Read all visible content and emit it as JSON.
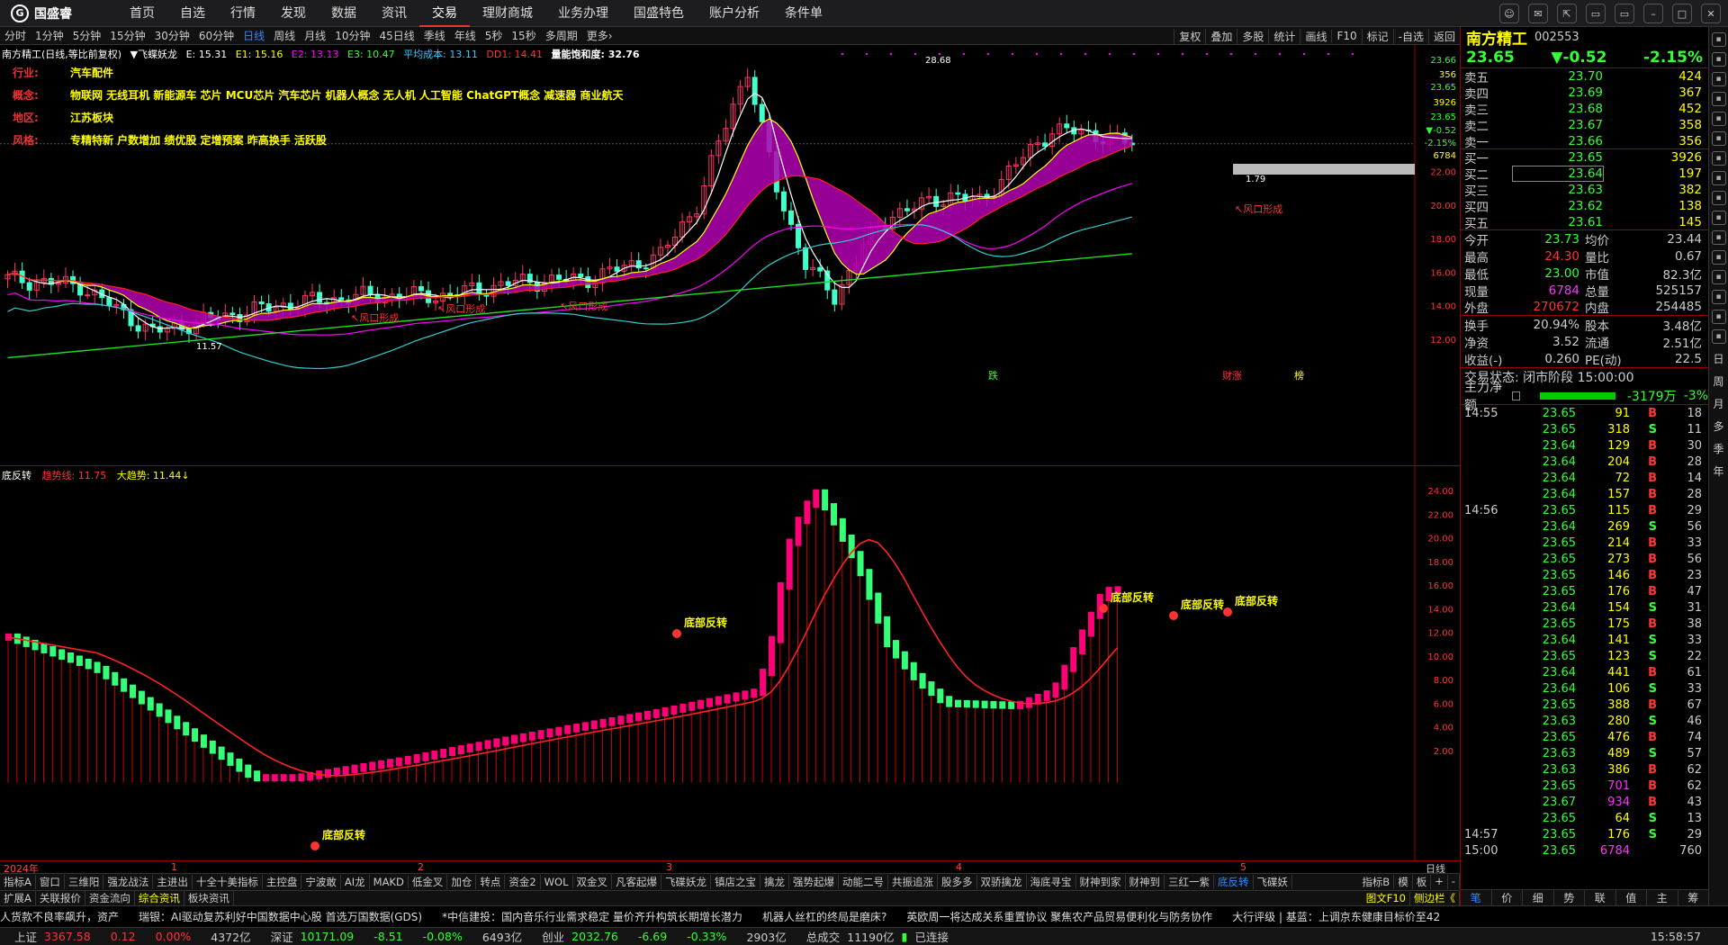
{
  "app": {
    "logo_text": "国盛睿",
    "logo_mark": "G"
  },
  "menu": [
    "首页",
    "自选",
    "行情",
    "发现",
    "数据",
    "资讯",
    "交易",
    "理财商城",
    "业务办理",
    "国盛特色",
    "账户分析",
    "条件单"
  ],
  "menu_active": 6,
  "window_controls": [
    "☺",
    "✉",
    "⇱",
    "▭",
    "▭",
    "–",
    "□",
    "✕"
  ],
  "periods": [
    "分时",
    "1分钟",
    "5分钟",
    "15分钟",
    "30分钟",
    "60分钟",
    "日线",
    "周线",
    "月线",
    "10分钟",
    "45日线",
    "季线",
    "年线",
    "5秒",
    "15秒",
    "多周期",
    "更多›"
  ],
  "period_active": 6,
  "chart_tools": [
    "复权",
    "叠加",
    "多股",
    "统计",
    "画线",
    "F10",
    "标记",
    "-自选",
    "返回"
  ],
  "main_info": {
    "title": "南方精工(日线,等比前复权)",
    "indicator": "▼飞蝶妖龙",
    "e": "E: 15.31",
    "e1": "E1: 15.16",
    "e2": "E2: 13.13",
    "e3": "E3: 10.47",
    "avg": "平均成本: 13.11",
    "dd": "DD1: 14.41",
    "qn": "量能饱和度: 32.76"
  },
  "info_blocks": [
    {
      "label": "行业:",
      "value": "汽车配件"
    },
    {
      "label": "概念:",
      "value": "物联网 无线耳机 新能源车 芯片 MCU芯片 汽车芯片 机器人概念 无人机 人工智能 ChatGPT概念 减速器 商业航天"
    },
    {
      "label": "地区:",
      "value": "江苏板块"
    },
    {
      "label": "风格:",
      "value": "专精特新 户数增加 绩优股 定增预案 昨高换手 活跃股"
    }
  ],
  "main_axis": [
    "23.66",
    "23.65",
    "23.65",
    "22.00",
    "20.00",
    "18.00",
    "16.00",
    "14.00",
    "12.00"
  ],
  "main_axis_extra": [
    "356",
    "3926",
    "▼-0.52",
    "-2.15%",
    "6784"
  ],
  "main_annotations": {
    "high": "28.68",
    "low": "11.57",
    "mid": "1.79",
    "wind": [
      "↖风口形成",
      "↖风口形成",
      "↖风口形成",
      "↖风口形成"
    ],
    "marks": [
      "跌",
      "财涨",
      "榜"
    ]
  },
  "sub_info": {
    "title": "底反转",
    "trend": "趋势线: 11.75",
    "big": "大趋势: 11.44↓"
  },
  "sub_axis": [
    "24.00",
    "22.00",
    "20.00",
    "18.00",
    "16.00",
    "14.00",
    "12.00",
    "10.00",
    "8.00",
    "6.00",
    "4.00",
    "2.00"
  ],
  "sub_annotations": [
    "底部反转",
    "底部反转",
    "底部反转",
    "底部反转",
    "底部反转"
  ],
  "time_axis": {
    "labels": [
      "2024年",
      "1",
      "2",
      "3",
      "4",
      "5"
    ],
    "right": "日线"
  },
  "indicator_tabs": [
    "指标A",
    "窗口",
    "三维阳",
    "强龙战法",
    "主进出",
    "十全十美指标",
    "主控盘",
    "宁波敢",
    "AI龙",
    "MAKD",
    "低金叉",
    "加仓",
    "转点",
    "资金2",
    "WOL",
    "双金叉",
    "凡客起爆",
    "飞碟妖龙",
    "镇店之宝",
    "擒龙",
    "强势起爆",
    "动能二号",
    "共振追涨",
    "股多多",
    "双骄擒龙",
    "海底寻宝",
    "财神到家",
    "财神到",
    "三红一紫",
    "底反转",
    "飞碟妖"
  ],
  "indicator_active": 29,
  "indicator_right": [
    "指标B",
    "模",
    "板",
    "+",
    "-"
  ],
  "bottom_tabs": [
    "扩展A",
    "关联报价",
    "资金流向",
    "综合资讯",
    "板块资讯"
  ],
  "bottom_active": 3,
  "bottom_right": [
    "图文F10",
    "侧边栏《"
  ],
  "news": [
    "人货款不良率飙升，资产",
    "瑞银：AI驱动复苏利好中国数据中心股 首选万国数据(GDS)",
    "*中信建投：国内音乐行业需求稳定 量价齐升构筑长期增长潜力",
    "机器人丝杠的终局是磨床?",
    "英欧周一将达成关系重置协议 聚焦农产品贸易便利化与防务协作",
    "大行评级 | 基蓝：上调京东健康目标价至42"
  ],
  "status": {
    "sh_label": "上证",
    "sh_val": "3367.58",
    "sh_chg": "0.12",
    "sh_pct": "0.00%",
    "sh_amt": "4372亿",
    "sz_label": "深证",
    "sz_val": "10171.09",
    "sz_chg": "-8.51",
    "sz_pct": "-0.08%",
    "sz_amt": "6493亿",
    "cy_label": "创业",
    "cy_val": "2032.76",
    "cy_chg": "-6.69",
    "cy_pct": "-0.33%",
    "cy_amt": "2903亿",
    "total_label": "总成交",
    "total": "11190亿",
    "conn": "已连接",
    "time": "15:58:57"
  },
  "quote": {
    "name": "南方精工",
    "code": "002553",
    "price": "23.65",
    "change": "▼-0.52",
    "pct": "-2.15%",
    "asks": [
      {
        "label": "卖五",
        "price": "23.70",
        "vol": "424"
      },
      {
        "label": "卖四",
        "price": "23.69",
        "vol": "367"
      },
      {
        "label": "卖三",
        "price": "23.68",
        "vol": "452"
      },
      {
        "label": "卖二",
        "price": "23.67",
        "vol": "358"
      },
      {
        "label": "卖一",
        "price": "23.66",
        "vol": "356"
      }
    ],
    "bids": [
      {
        "label": "买一",
        "price": "23.65",
        "vol": "3926"
      },
      {
        "label": "买二",
        "price": "23.64",
        "vol": "197"
      },
      {
        "label": "买三",
        "price": "23.63",
        "vol": "382"
      },
      {
        "label": "买四",
        "price": "23.62",
        "vol": "138"
      },
      {
        "label": "买五",
        "price": "23.61",
        "vol": "145"
      }
    ],
    "stats": [
      [
        "今开",
        "23.73",
        "均价",
        "23.44",
        "#3f3"
      ],
      [
        "最高",
        "24.30",
        "量比",
        "0.67",
        "#f33"
      ],
      [
        "最低",
        "23.00",
        "市值",
        "82.3亿",
        "#3f3"
      ],
      [
        "现量",
        "6784",
        "总量",
        "525157",
        "#f3f"
      ],
      [
        "外盘",
        "270672",
        "内盘",
        "254485",
        "#f33"
      ],
      [
        "换手",
        "20.94%",
        "股本",
        "3.48亿",
        "#ccc"
      ],
      [
        "净资",
        "3.52",
        "流通",
        "2.51亿",
        "#ccc"
      ],
      [
        "收益(-)",
        "0.260",
        "PE(动)",
        "22.5",
        "#ccc"
      ]
    ],
    "status": "交易状态: 闭市阶段 15:00:00",
    "net_label": "主力净额",
    "net_val": "-3179万",
    "net_pct": "-3%"
  },
  "ticks": [
    [
      "14:55",
      "23.65",
      "91",
      "B",
      "18"
    ],
    [
      "",
      "23.65",
      "318",
      "S",
      "11"
    ],
    [
      "",
      "23.64",
      "129",
      "B",
      "30"
    ],
    [
      "",
      "23.64",
      "204",
      "B",
      "28"
    ],
    [
      "",
      "23.64",
      "72",
      "B",
      "14"
    ],
    [
      "",
      "23.64",
      "157",
      "B",
      "28"
    ],
    [
      "14:56",
      "23.65",
      "115",
      "B",
      "29"
    ],
    [
      "",
      "23.64",
      "269",
      "S",
      "56"
    ],
    [
      "",
      "23.65",
      "214",
      "B",
      "33"
    ],
    [
      "",
      "23.65",
      "273",
      "B",
      "56"
    ],
    [
      "",
      "23.65",
      "146",
      "B",
      "23"
    ],
    [
      "",
      "23.65",
      "176",
      "B",
      "47"
    ],
    [
      "",
      "23.64",
      "154",
      "S",
      "31"
    ],
    [
      "",
      "23.65",
      "175",
      "B",
      "38"
    ],
    [
      "",
      "23.64",
      "141",
      "S",
      "33"
    ],
    [
      "",
      "23.65",
      "123",
      "S",
      "22"
    ],
    [
      "",
      "23.64",
      "441",
      "B",
      "61"
    ],
    [
      "",
      "23.64",
      "106",
      "S",
      "33"
    ],
    [
      "",
      "23.65",
      "388",
      "B",
      "67"
    ],
    [
      "",
      "23.63",
      "280",
      "S",
      "46"
    ],
    [
      "",
      "23.65",
      "476",
      "B",
      "74"
    ],
    [
      "",
      "23.63",
      "489",
      "S",
      "57"
    ],
    [
      "",
      "23.63",
      "386",
      "B",
      "62"
    ],
    [
      "",
      "23.65",
      "701",
      "B",
      "62"
    ],
    [
      "",
      "23.67",
      "934",
      "B",
      "43"
    ],
    [
      "",
      "23.65",
      "64",
      "S",
      "13"
    ],
    [
      "14:57",
      "23.65",
      "176",
      "S",
      "29"
    ],
    [
      "15:00",
      "23.65",
      "6784",
      "",
      "760"
    ]
  ],
  "rp_foot": [
    "笔",
    "价",
    "细",
    "势",
    "联",
    "值",
    "主",
    "筹"
  ],
  "side_labels": [
    "日",
    "周",
    "月",
    "多",
    "季",
    "年"
  ],
  "colors": {
    "up": "#ff3366",
    "down": "#44ffcc",
    "ma_white": "#ffffff",
    "ma_yellow": "#ffff00",
    "ma_red": "#ff2020",
    "ma_magenta": "#ff00ff",
    "ma_cyan": "#33cccc",
    "ma_green": "#22dd22",
    "fill": "#b000b0"
  }
}
